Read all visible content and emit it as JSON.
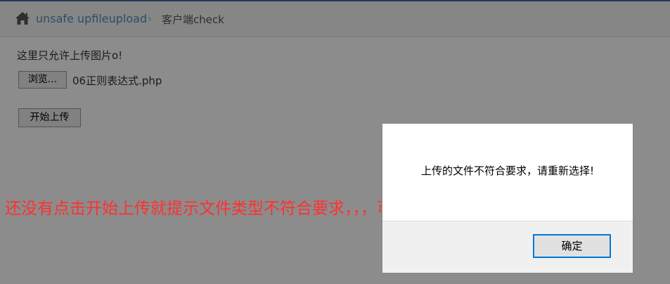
{
  "breadcrumb": {
    "home_icon": "home-icon",
    "link_label": "unsafe upfileupload",
    "separator": "›",
    "current_label": "客户端check"
  },
  "main": {
    "notice": "这里只允许上传图片o!",
    "browse_label": "浏览...",
    "file_name": "06正则表达式.php",
    "upload_label": "开始上传"
  },
  "dialog": {
    "message": "上传的文件不符合要求，请重新选择!",
    "ok_label": "确定"
  },
  "annotation": {
    "text": "还没有点击开始上传就提示文件类型不符合要求，，，可以判断是前端校验"
  },
  "colors": {
    "link": "#4c8fbd",
    "annotation": "#ff3030",
    "dialog_focus": "#0078d7",
    "top_strip": "#3a6d9e"
  }
}
